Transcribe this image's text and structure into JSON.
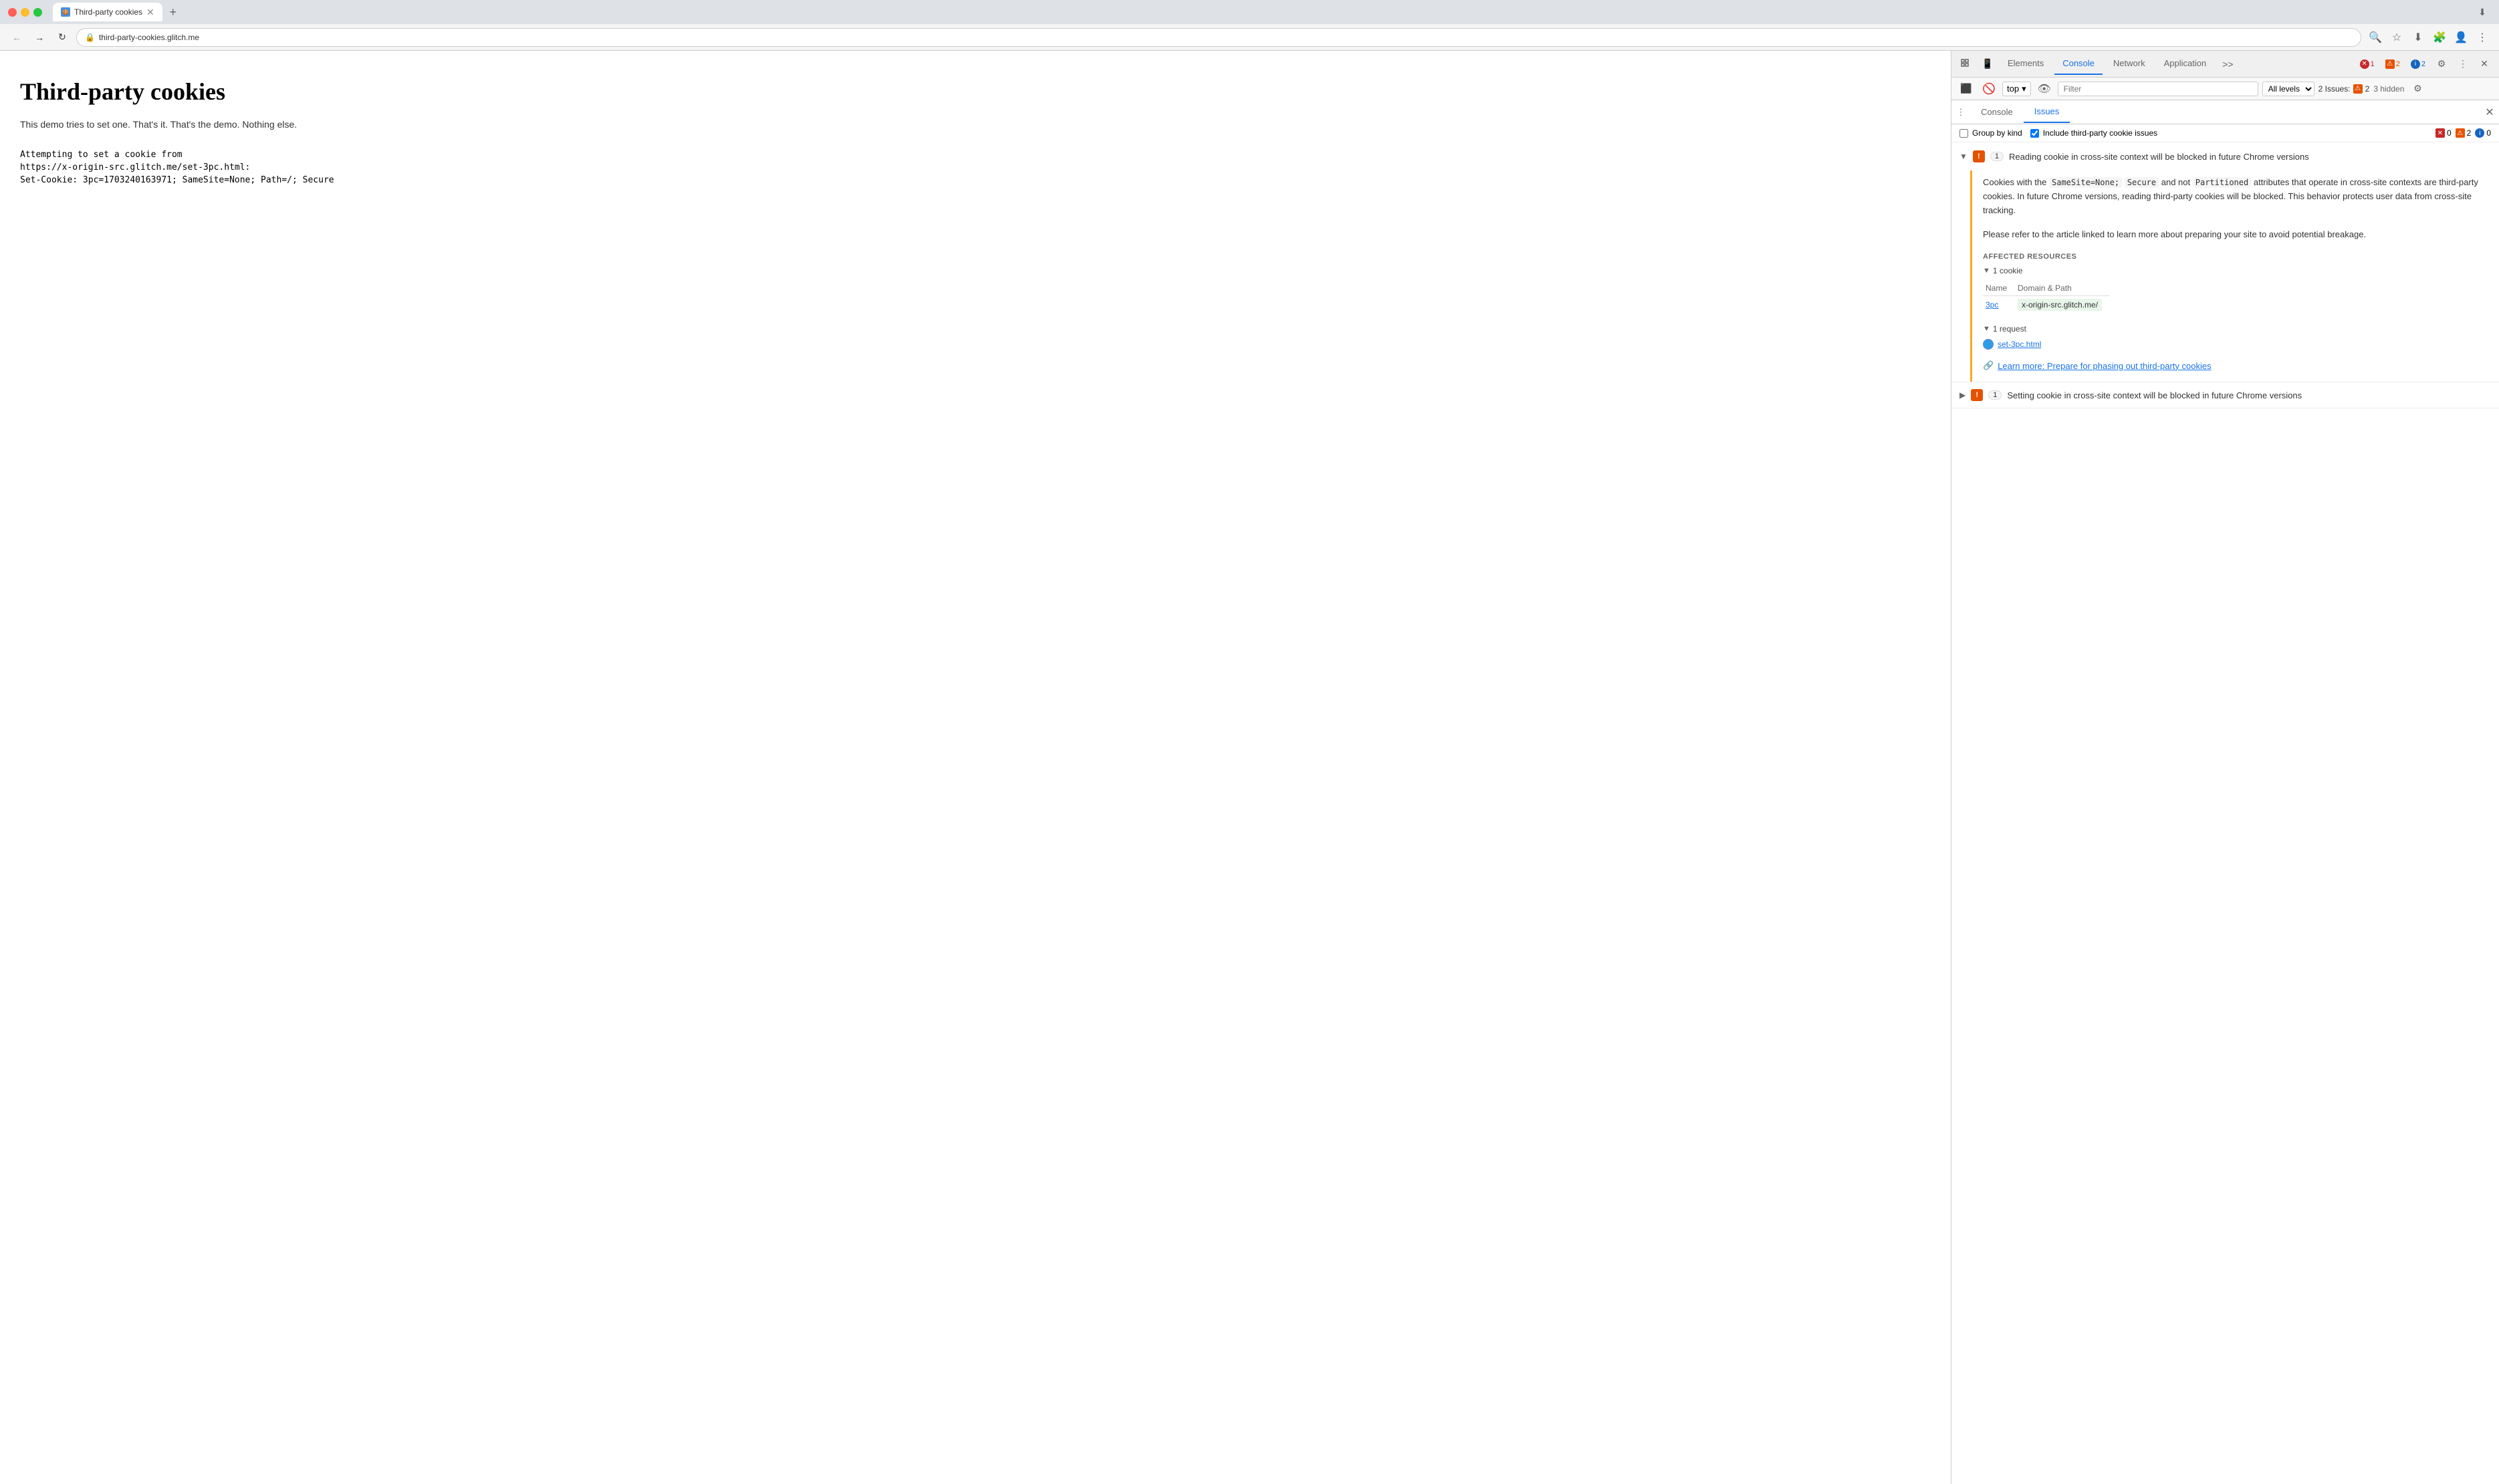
{
  "browser": {
    "tab": {
      "title": "Third-party cookies",
      "favicon_text": "🍪"
    },
    "address": "third-party-cookies.glitch.me"
  },
  "page": {
    "title": "Third-party cookies",
    "description": "This demo tries to set one. That's it. That's the demo. Nothing else.",
    "cookie_info": {
      "line1": "Attempting to set a cookie from",
      "line2": "https://x-origin-src.glitch.me/set-3pc.html:",
      "line3": "Set-Cookie: 3pc=1703240163971; SameSite=None; Path=/; Secure"
    }
  },
  "devtools": {
    "tabs": [
      {
        "label": "Elements",
        "active": false
      },
      {
        "label": "Console",
        "active": false
      },
      {
        "label": "Issues",
        "active": true
      },
      {
        "label": "Network",
        "active": false
      },
      {
        "label": "Application",
        "active": false
      }
    ],
    "status": {
      "errors": "1",
      "warnings": "2",
      "info": "2"
    },
    "toolbar2": {
      "context": "top",
      "filter_placeholder": "Filter",
      "level": "All levels",
      "issues_label": "2 Issues:",
      "issues_count": "2",
      "hidden": "3 hidden"
    },
    "issues_panel": {
      "tabs": [
        {
          "label": "Console",
          "active": false
        },
        {
          "label": "Issues",
          "active": true
        }
      ],
      "options": {
        "group_by_kind": "Group by kind",
        "include_third_party": "Include third-party cookie issues",
        "counts": {
          "errors": "0",
          "warnings": "2",
          "info": "0"
        }
      },
      "issues": [
        {
          "id": "issue1",
          "expanded": true,
          "icon_type": "warning",
          "count": "1",
          "title": "Reading cookie in cross-site context will be blocked in future Chrome versions",
          "description_parts": [
            {
              "type": "text",
              "content": "Cookies with the "
            },
            {
              "type": "code",
              "content": "SameSite=None;"
            },
            {
              "type": "text",
              "content": " "
            },
            {
              "type": "code",
              "content": "Secure"
            },
            {
              "type": "text",
              "content": " and not "
            },
            {
              "type": "code",
              "content": "Partitioned"
            },
            {
              "type": "text",
              "content": " attributes that operate in cross-site contexts are third-party cookies. In future Chrome versions, reading third-party cookies will be blocked. This behavior protects user data from cross-site tracking."
            }
          ],
          "description2": "Please refer to the article linked to learn more about preparing your site to avoid potential breakage.",
          "affected_resources_label": "AFFECTED RESOURCES",
          "cookie_group": {
            "label": "1 cookie",
            "columns": [
              "Name",
              "Domain & Path"
            ],
            "rows": [
              {
                "name": "3pc",
                "domain": "x-origin-src.glitch.me/"
              }
            ]
          },
          "request_group": {
            "label": "1 request",
            "items": [
              {
                "label": "set-3pc.html"
              }
            ]
          },
          "learn_more": {
            "label": "Learn more: Prepare for phasing out third-party cookies",
            "url": "#"
          }
        },
        {
          "id": "issue2",
          "expanded": false,
          "icon_type": "warning",
          "count": "1",
          "title": "Setting cookie in cross-site context will be blocked in future Chrome versions"
        }
      ]
    }
  }
}
